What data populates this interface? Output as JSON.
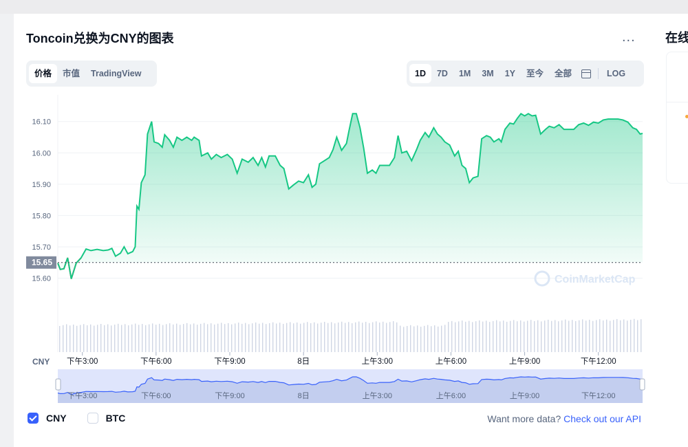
{
  "title": "Toncoin兑换为CNY的图表",
  "side_title": "在线",
  "more_label": "...",
  "tabs_left": [
    {
      "label": "价格",
      "active": true
    },
    {
      "label": "市值",
      "active": false
    },
    {
      "label": "TradingView",
      "active": false
    }
  ],
  "tabs_right": [
    {
      "label": "1D",
      "active": true
    },
    {
      "label": "7D",
      "active": false
    },
    {
      "label": "1M",
      "active": false
    },
    {
      "label": "3M",
      "active": false
    },
    {
      "label": "1Y",
      "active": false
    },
    {
      "label": "至今",
      "active": false
    },
    {
      "label": "全部",
      "active": false
    }
  ],
  "log_label": "LOG",
  "calendar_icon": "calendar-icon",
  "watermark": "CoinMarketCap",
  "legend": {
    "cny_label": "CNY",
    "btc_label": "BTC",
    "cny_checked": true,
    "btc_checked": false
  },
  "api": {
    "prompt": "Want more data?",
    "link": "Check out our API"
  },
  "colors": {
    "up": "#16c784",
    "down": "#ea3943",
    "accent": "#3861fb",
    "nav_fill": "#dfe5fc"
  },
  "chart_data": {
    "type": "line",
    "y_unit_label": "CNY",
    "y_ticks": [
      16.1,
      16.0,
      15.9,
      15.8,
      15.7,
      15.6
    ],
    "ylim": [
      15.555,
      16.185
    ],
    "reference_price": 15.65,
    "reference_label": "15.65",
    "x_tick_labels": [
      "下午3:00",
      "下午6:00",
      "下午9:00",
      "8日",
      "上午3:00",
      "上午6:00",
      "上午9:00",
      "下午12:00"
    ],
    "x_tick_positions": [
      1,
      4,
      7,
      10,
      13,
      16,
      19,
      22
    ],
    "x_range": [
      0,
      23.8
    ],
    "price": [
      [
        0.0,
        15.648
      ],
      [
        0.1,
        15.628
      ],
      [
        0.25,
        15.63
      ],
      [
        0.4,
        15.665
      ],
      [
        0.55,
        15.598
      ],
      [
        0.75,
        15.648
      ],
      [
        0.95,
        15.665
      ],
      [
        1.15,
        15.693
      ],
      [
        1.35,
        15.688
      ],
      [
        1.6,
        15.692
      ],
      [
        1.85,
        15.688
      ],
      [
        2.05,
        15.69
      ],
      [
        2.2,
        15.695
      ],
      [
        2.35,
        15.67
      ],
      [
        2.55,
        15.68
      ],
      [
        2.7,
        15.7
      ],
      [
        2.85,
        15.678
      ],
      [
        3.05,
        15.685
      ],
      [
        3.15,
        15.7
      ],
      [
        3.22,
        15.83
      ],
      [
        3.3,
        15.82
      ],
      [
        3.4,
        15.905
      ],
      [
        3.55,
        15.93
      ],
      [
        3.65,
        16.06
      ],
      [
        3.82,
        16.1
      ],
      [
        3.92,
        16.035
      ],
      [
        4.1,
        16.03
      ],
      [
        4.25,
        16.018
      ],
      [
        4.35,
        16.058
      ],
      [
        4.55,
        16.04
      ],
      [
        4.7,
        16.018
      ],
      [
        4.85,
        16.05
      ],
      [
        5.05,
        16.04
      ],
      [
        5.25,
        16.05
      ],
      [
        5.45,
        16.04
      ],
      [
        5.55,
        16.05
      ],
      [
        5.75,
        16.04
      ],
      [
        5.85,
        15.99
      ],
      [
        6.1,
        16.0
      ],
      [
        6.25,
        15.98
      ],
      [
        6.45,
        15.995
      ],
      [
        6.65,
        15.985
      ],
      [
        6.9,
        15.995
      ],
      [
        7.1,
        15.98
      ],
      [
        7.3,
        15.935
      ],
      [
        7.5,
        15.98
      ],
      [
        7.75,
        15.97
      ],
      [
        7.95,
        15.985
      ],
      [
        8.15,
        15.96
      ],
      [
        8.3,
        15.985
      ],
      [
        8.45,
        15.955
      ],
      [
        8.6,
        15.99
      ],
      [
        8.85,
        15.99
      ],
      [
        9.05,
        15.96
      ],
      [
        9.2,
        15.95
      ],
      [
        9.4,
        15.885
      ],
      [
        9.6,
        15.898
      ],
      [
        9.8,
        15.91
      ],
      [
        10.0,
        15.905
      ],
      [
        10.2,
        15.93
      ],
      [
        10.35,
        15.89
      ],
      [
        10.5,
        15.9
      ],
      [
        10.65,
        15.965
      ],
      [
        10.85,
        15.975
      ],
      [
        11.05,
        15.985
      ],
      [
        11.2,
        16.01
      ],
      [
        11.35,
        16.05
      ],
      [
        11.55,
        16.008
      ],
      [
        11.75,
        16.03
      ],
      [
        11.85,
        16.07
      ],
      [
        12.0,
        16.125
      ],
      [
        12.15,
        16.125
      ],
      [
        12.3,
        16.08
      ],
      [
        12.45,
        16.015
      ],
      [
        12.6,
        15.935
      ],
      [
        12.8,
        15.945
      ],
      [
        12.95,
        15.935
      ],
      [
        13.1,
        15.96
      ],
      [
        13.3,
        15.96
      ],
      [
        13.5,
        15.96
      ],
      [
        13.7,
        15.985
      ],
      [
        13.85,
        16.055
      ],
      [
        14.0,
        16.0
      ],
      [
        14.2,
        16.005
      ],
      [
        14.4,
        15.975
      ],
      [
        14.6,
        16.01
      ],
      [
        14.75,
        16.04
      ],
      [
        14.95,
        16.065
      ],
      [
        15.1,
        16.05
      ],
      [
        15.3,
        16.08
      ],
      [
        15.45,
        16.06
      ],
      [
        15.6,
        16.05
      ],
      [
        15.75,
        16.035
      ],
      [
        15.95,
        16.025
      ],
      [
        16.15,
        15.99
      ],
      [
        16.3,
        16.005
      ],
      [
        16.45,
        15.96
      ],
      [
        16.6,
        15.95
      ],
      [
        16.75,
        15.905
      ],
      [
        16.9,
        15.92
      ],
      [
        17.1,
        15.925
      ],
      [
        17.25,
        16.045
      ],
      [
        17.45,
        16.055
      ],
      [
        17.6,
        16.05
      ],
      [
        17.75,
        16.035
      ],
      [
        17.95,
        16.045
      ],
      [
        18.05,
        16.035
      ],
      [
        18.2,
        16.075
      ],
      [
        18.4,
        16.095
      ],
      [
        18.55,
        16.092
      ],
      [
        18.7,
        16.11
      ],
      [
        18.85,
        16.125
      ],
      [
        19.0,
        16.118
      ],
      [
        19.15,
        16.125
      ],
      [
        19.3,
        16.118
      ],
      [
        19.45,
        16.12
      ],
      [
        19.65,
        16.06
      ],
      [
        19.85,
        16.075
      ],
      [
        20.0,
        16.085
      ],
      [
        20.2,
        16.08
      ],
      [
        20.4,
        16.09
      ],
      [
        20.6,
        16.075
      ],
      [
        20.8,
        16.075
      ],
      [
        21.0,
        16.075
      ],
      [
        21.2,
        16.09
      ],
      [
        21.4,
        16.095
      ],
      [
        21.6,
        16.088
      ],
      [
        21.8,
        16.098
      ],
      [
        22.0,
        16.095
      ],
      [
        22.2,
        16.105
      ],
      [
        22.4,
        16.108
      ],
      [
        22.6,
        16.108
      ],
      [
        22.8,
        16.108
      ],
      [
        23.0,
        16.105
      ],
      [
        23.2,
        16.098
      ],
      [
        23.4,
        16.08
      ],
      [
        23.55,
        16.075
      ],
      [
        23.7,
        16.06
      ],
      [
        23.8,
        16.062
      ]
    ]
  }
}
